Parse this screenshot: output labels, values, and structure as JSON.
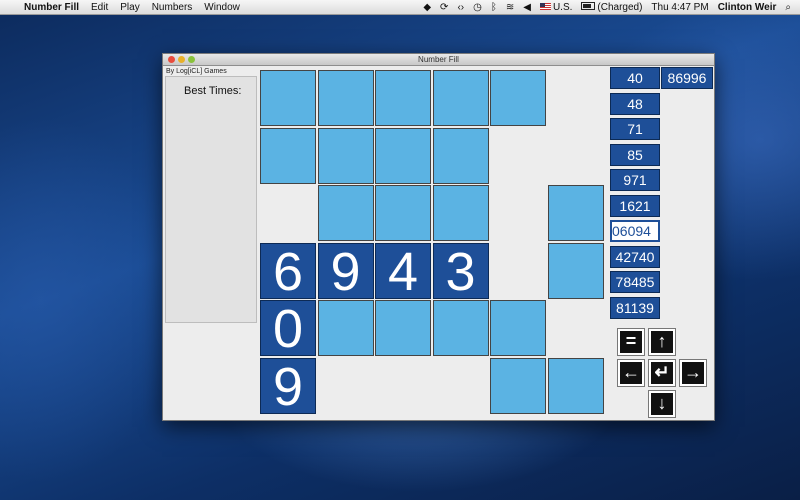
{
  "menubar": {
    "apple": "",
    "app_name": "Number Fill",
    "menus": [
      "Edit",
      "Play",
      "Numbers",
      "Window"
    ],
    "status": {
      "input": "U.S.",
      "battery": "(Charged)",
      "clock": "Thu 4:47 PM",
      "user": "Clinton Weir"
    },
    "icons": [
      "dropbox-icon",
      "sync-icon",
      "code-icon",
      "time-machine-icon",
      "bluetooth-icon",
      "wifi-icon",
      "volume-icon",
      "search-icon"
    ]
  },
  "window": {
    "title": "Number Fill",
    "tab_label": "By Log[iCL] Games",
    "best_times_label": "Best Times:"
  },
  "board": {
    "rows": [
      [
        "L",
        "L",
        "L",
        "L",
        "L",
        "E"
      ],
      [
        "L",
        "L",
        "L",
        "L",
        "E",
        "E"
      ],
      [
        "E",
        "L",
        "L",
        "L",
        "E",
        "L"
      ],
      [
        "6",
        "9",
        "4",
        "3",
        "E",
        "L"
      ],
      [
        "0",
        "L",
        "L",
        "L",
        "L",
        "E"
      ],
      [
        "9",
        "E",
        "E",
        "E",
        "L",
        "L"
      ]
    ],
    "colors": {
      "light": "#5bb3e3",
      "digit": "#1e4f98"
    }
  },
  "numbers": {
    "list": [
      "40",
      "48",
      "71",
      "85",
      "971",
      "1621",
      "06094",
      "42740",
      "78485",
      "81139"
    ],
    "extra": "86996",
    "selected_index": 6
  },
  "controls": {
    "equals": "=",
    "up": "↑",
    "left": "←",
    "enter": "↵",
    "right": "→",
    "down": "↓"
  }
}
